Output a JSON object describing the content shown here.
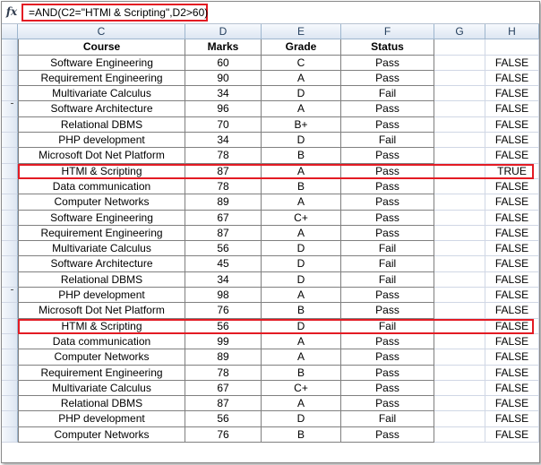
{
  "formula_bar": {
    "fx_label": "fx",
    "formula": "=AND(C2=\"HTMl & Scripting\",D2>60)"
  },
  "columns": [
    "C",
    "D",
    "E",
    "F",
    "G",
    "H"
  ],
  "header": {
    "course": "Course",
    "marks": "Marks",
    "grade": "Grade",
    "status": "Status"
  },
  "highlighted_rows": [
    7,
    17
  ],
  "colors": {
    "highlight": "#e31b23",
    "header_bg": "#dde6f2",
    "grid_line": "#d0d7e5"
  },
  "rows": [
    {
      "course": "Software Engineering",
      "marks": "60",
      "grade": "C",
      "status": "Pass",
      "result": "FALSE"
    },
    {
      "course": "Requirement Engineering",
      "marks": "90",
      "grade": "A",
      "status": "Pass",
      "result": "FALSE"
    },
    {
      "course": "Multivariate Calculus",
      "marks": "34",
      "grade": "D",
      "status": "Fail",
      "result": "FALSE"
    },
    {
      "course": "Software Architecture",
      "marks": "96",
      "grade": "A",
      "status": "Pass",
      "result": "FALSE"
    },
    {
      "course": "Relational DBMS",
      "marks": "70",
      "grade": "B+",
      "status": "Pass",
      "result": "FALSE"
    },
    {
      "course": "PHP development",
      "marks": "34",
      "grade": "D",
      "status": "Fail",
      "result": "FALSE"
    },
    {
      "course": "Microsoft Dot Net Platform",
      "marks": "78",
      "grade": "B",
      "status": "Pass",
      "result": "FALSE"
    },
    {
      "course": "HTMl & Scripting",
      "marks": "87",
      "grade": "A",
      "status": "Pass",
      "result": "TRUE"
    },
    {
      "course": "Data communication",
      "marks": "78",
      "grade": "B",
      "status": "Pass",
      "result": "FALSE"
    },
    {
      "course": "Computer Networks",
      "marks": "89",
      "grade": "A",
      "status": "Pass",
      "result": "FALSE"
    },
    {
      "course": "Software Engineering",
      "marks": "67",
      "grade": "C+",
      "status": "Pass",
      "result": "FALSE"
    },
    {
      "course": "Requirement Engineering",
      "marks": "87",
      "grade": "A",
      "status": "Pass",
      "result": "FALSE"
    },
    {
      "course": "Multivariate Calculus",
      "marks": "56",
      "grade": "D",
      "status": "Fail",
      "result": "FALSE"
    },
    {
      "course": "Software Architecture",
      "marks": "45",
      "grade": "D",
      "status": "Fail",
      "result": "FALSE"
    },
    {
      "course": "Relational DBMS",
      "marks": "34",
      "grade": "D",
      "status": "Fail",
      "result": "FALSE"
    },
    {
      "course": "PHP development",
      "marks": "98",
      "grade": "A",
      "status": "Pass",
      "result": "FALSE"
    },
    {
      "course": "Microsoft Dot Net Platform",
      "marks": "76",
      "grade": "B",
      "status": "Pass",
      "result": "FALSE"
    },
    {
      "course": "HTMl & Scripting",
      "marks": "56",
      "grade": "D",
      "status": "Fail",
      "result": "FALSE"
    },
    {
      "course": "Data communication",
      "marks": "99",
      "grade": "A",
      "status": "Pass",
      "result": "FALSE"
    },
    {
      "course": "Computer Networks",
      "marks": "89",
      "grade": "A",
      "status": "Pass",
      "result": "FALSE"
    },
    {
      "course": "Requirement Engineering",
      "marks": "78",
      "grade": "B",
      "status": "Pass",
      "result": "FALSE"
    },
    {
      "course": "Multivariate Calculus",
      "marks": "67",
      "grade": "C+",
      "status": "Pass",
      "result": "FALSE"
    },
    {
      "course": "Relational DBMS",
      "marks": "87",
      "grade": "A",
      "status": "Pass",
      "result": "FALSE"
    },
    {
      "course": "PHP development",
      "marks": "56",
      "grade": "D",
      "status": "Fail",
      "result": "FALSE"
    },
    {
      "course": "Computer Networks",
      "marks": "76",
      "grade": "B",
      "status": "Pass",
      "result": "FALSE"
    }
  ]
}
